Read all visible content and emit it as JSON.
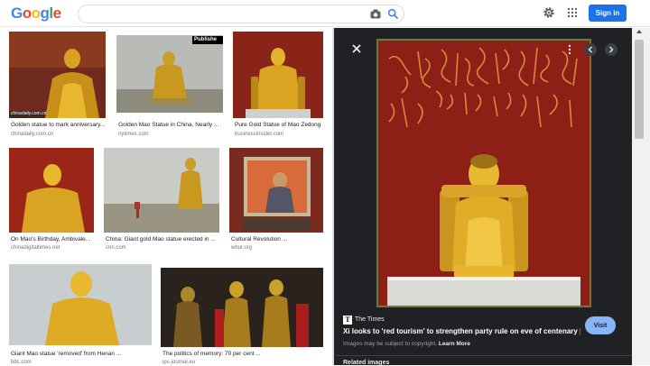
{
  "header": {
    "logo_letters": [
      {
        "ch": "G",
        "color": "#4285f4"
      },
      {
        "ch": "o",
        "color": "#ea4335"
      },
      {
        "ch": "o",
        "color": "#fbbc05"
      },
      {
        "ch": "g",
        "color": "#4285f4"
      },
      {
        "ch": "l",
        "color": "#34a853"
      },
      {
        "ch": "e",
        "color": "#ea4335"
      }
    ],
    "search_value": "",
    "icons": [
      "camera-icon",
      "search-icon",
      "gear-icon",
      "apps-icon"
    ],
    "signin_label": "Sign in",
    "accent": "#1a73e8"
  },
  "results": [
    {
      "caption": "Golden statue to mark anniversary...",
      "source": "chinadaily.com.cn",
      "watermark": "chinadaily.com.cn"
    },
    {
      "caption": "Golden Mao Statue in China, Nearly ...",
      "source": "nytimes.com",
      "watermark": "Publishe"
    },
    {
      "caption": "Pure Gold Statue of Mao Zedong",
      "source": "businessinsider.com"
    },
    {
      "caption": "On Mao's Birthday, Ambivale...",
      "source": "chinadigitaltimes.net"
    },
    {
      "caption": "China: Giant gold Mao statue erected in ...",
      "source": "cnn.com"
    },
    {
      "caption": "Cultural Revolution ...",
      "source": "wbur.org"
    },
    {
      "caption": "Giant Mao statue 'removed' from Henan ...",
      "source": "bbc.com"
    },
    {
      "caption": "The politics of memory: 70 per cent ...",
      "source": "ips-journal.eu"
    }
  ],
  "panel": {
    "source_logo": "T",
    "source_name": "The Times",
    "title": "Xi looks to 'red tourism' to strengthen party rule on eve of centenary | W...",
    "note_prefix": "Images may be subject to copyright.",
    "learn_more": "Learn More",
    "visit_label": "Visit",
    "related_heading": "Related images",
    "icons": [
      "close-icon",
      "more-icon",
      "chevron-left-icon",
      "chevron-right-icon"
    ]
  }
}
